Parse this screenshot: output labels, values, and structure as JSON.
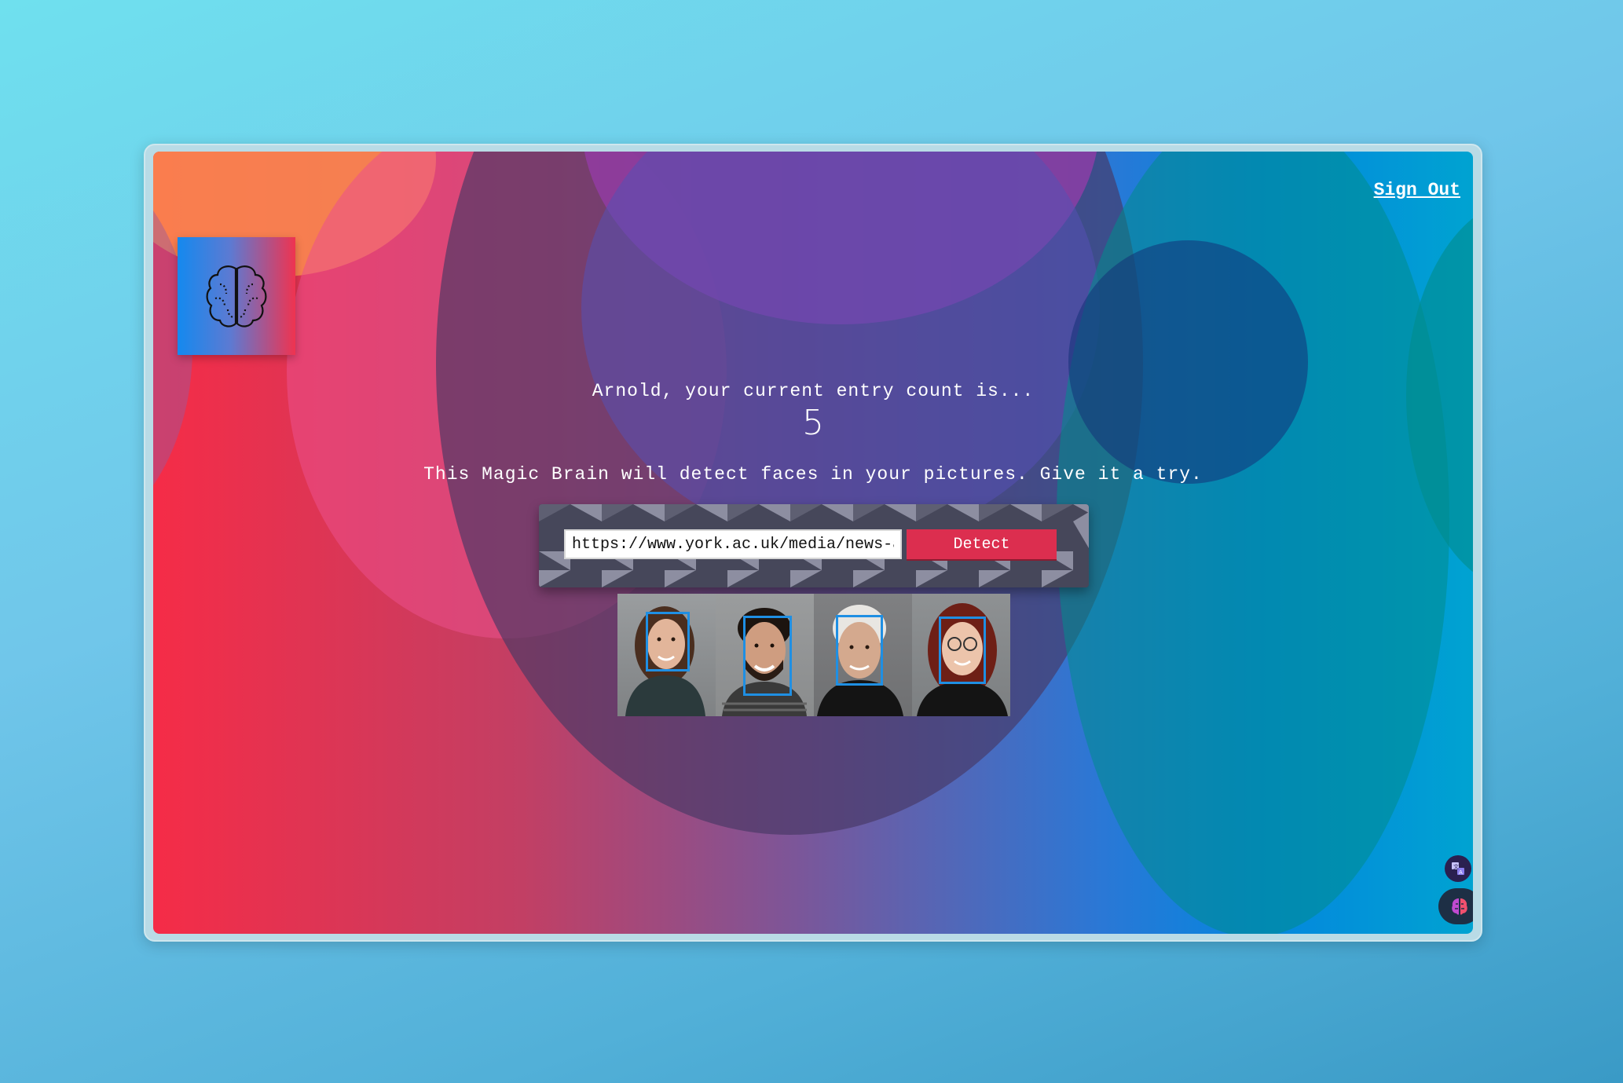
{
  "nav": {
    "sign_out_label": "Sign Out"
  },
  "logo": {
    "icon": "brain-icon"
  },
  "entries": {
    "greeting": "Arnold, your current entry count is...",
    "count": "5"
  },
  "tagline": "This Magic Brain will detect faces in your pictures. Give it a try.",
  "form": {
    "url_value": "https://www.york.ac.uk/media/news-ar",
    "detect_label": "Detect"
  },
  "result_image": {
    "faces_detected": 4,
    "accent_color": "#1f8fe3"
  },
  "floating": {
    "translate_icon": "translate-icon",
    "extension_icon": "brain-extension-icon"
  },
  "colors": {
    "detect_button": "#dc2e4f",
    "sign_out": "#ffffff"
  }
}
